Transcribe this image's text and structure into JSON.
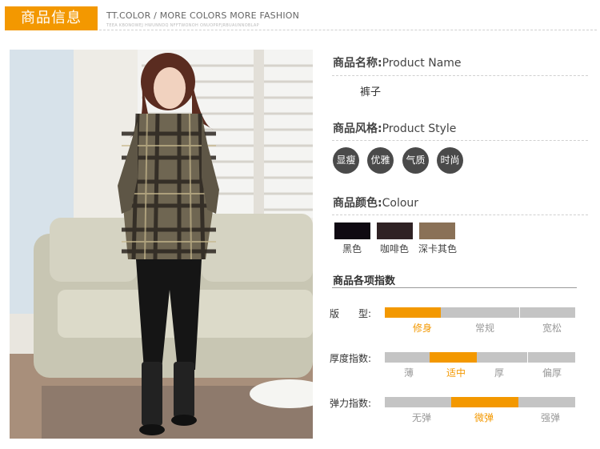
{
  "header": {
    "tab_label": "商品信息",
    "title": "TT.COLOR / MORE COLORS MORE FASHION",
    "subtitle": "TEEA KBONOWEJ HWUNNDQ NFFTWONOH ONUOPRFJRBUAUNNOBLAP"
  },
  "product_name": {
    "label_cn": "商品名称:",
    "label_en": "Product Name",
    "value": "裤子"
  },
  "product_style": {
    "label_cn": "商品风格:",
    "label_en": "Product Style",
    "tags": [
      "显瘦",
      "优雅",
      "气质",
      "时尚"
    ]
  },
  "colour": {
    "label_cn": "商品颜色:",
    "label_en": "Colour",
    "swatches": [
      {
        "name": "黑色",
        "hex": "#0f0a12"
      },
      {
        "name": "咖啡色",
        "hex": "#2f2224"
      },
      {
        "name": "深卡其色",
        "hex": "#8a7157"
      }
    ]
  },
  "indices": {
    "title": "商品各项指数",
    "accent": "#f39800",
    "rows": [
      {
        "label": "版　　型:",
        "options": [
          "修身",
          "常规",
          "宽松"
        ],
        "selected": 0
      },
      {
        "label": "厚度指数:",
        "options": [
          "薄",
          "适中",
          "厚",
          "偏厚"
        ],
        "selected": 1
      },
      {
        "label": "弹力指数:",
        "options": [
          "无弹",
          "微弹",
          "强弹"
        ],
        "selected": 1
      }
    ]
  }
}
